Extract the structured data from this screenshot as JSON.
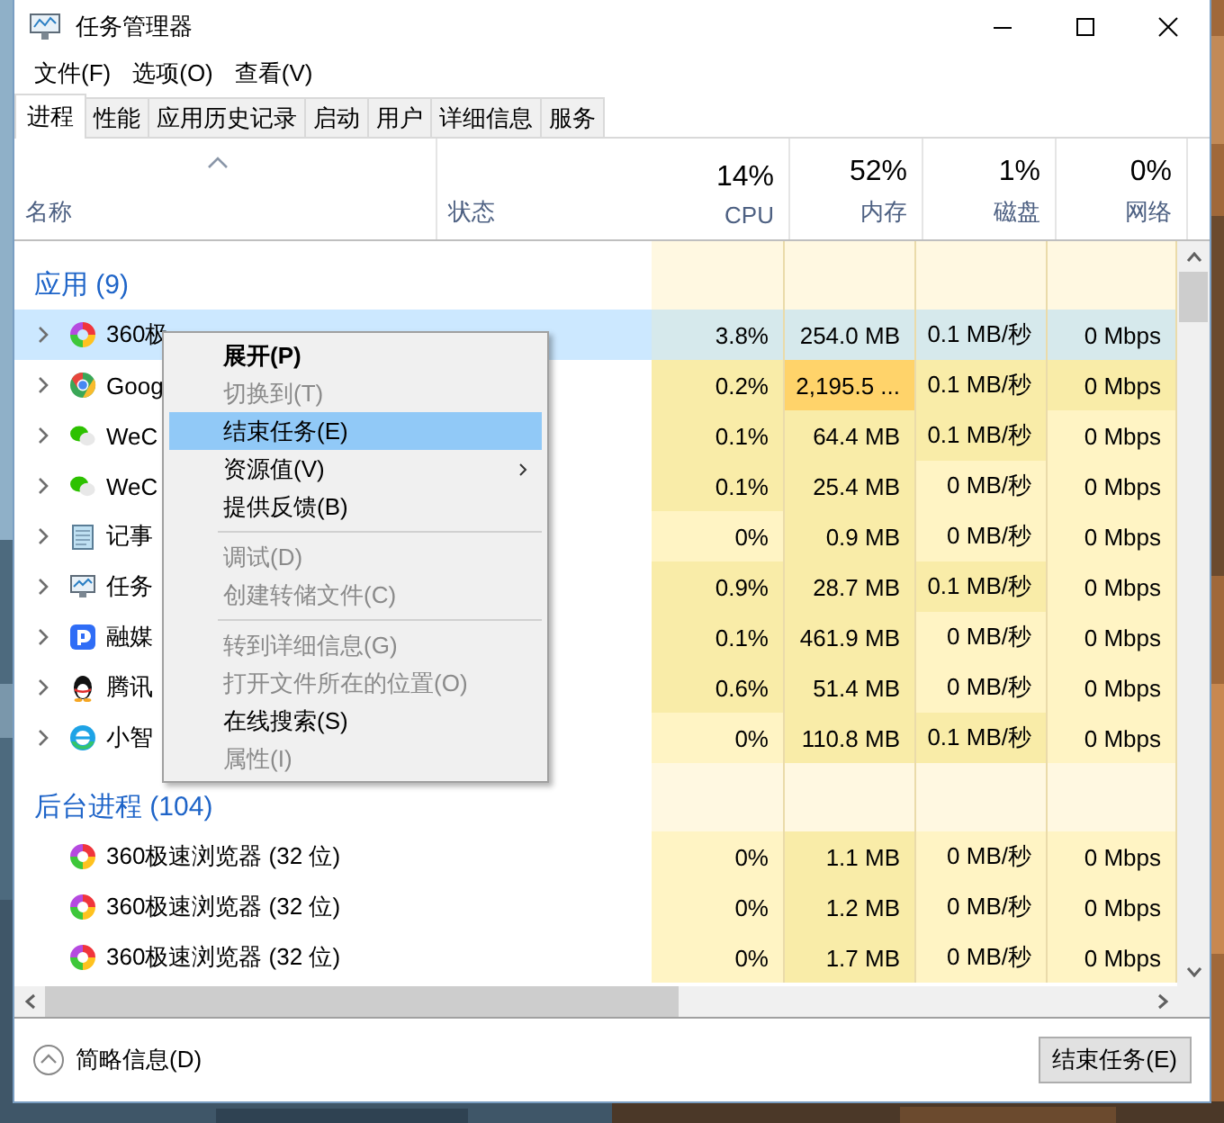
{
  "window": {
    "title": "任务管理器"
  },
  "menu_bar": [
    "文件(F)",
    "选项(O)",
    "查看(V)"
  ],
  "tabs": [
    {
      "label": "进程",
      "selected": true
    },
    {
      "label": "性能",
      "selected": false
    },
    {
      "label": "应用历史记录",
      "selected": false
    },
    {
      "label": "启动",
      "selected": false
    },
    {
      "label": "用户",
      "selected": false
    },
    {
      "label": "详细信息",
      "selected": false
    },
    {
      "label": "服务",
      "selected": false
    }
  ],
  "columns": {
    "name": {
      "label": "名称",
      "sorted": true
    },
    "status": {
      "label": "状态"
    },
    "metrics": [
      {
        "percent": "14%",
        "label": "CPU"
      },
      {
        "percent": "52%",
        "label": "内存"
      },
      {
        "percent": "1%",
        "label": "磁盘"
      },
      {
        "percent": "0%",
        "label": "网络"
      }
    ]
  },
  "groups": [
    {
      "title": "应用 (9)",
      "rows": [
        {
          "name": "360极",
          "expandable": true,
          "selected": true,
          "cells": [
            {
              "text": "3.8%",
              "color": "#d6e9ec"
            },
            {
              "text": "254.0 MB",
              "color": "#d6e9ec"
            },
            {
              "text": "0.1 MB/秒",
              "color": "#d6e9ec"
            },
            {
              "text": "0 Mbps",
              "color": "#d6e9ec"
            }
          ]
        },
        {
          "name": "Goog",
          "expandable": true,
          "selected": false,
          "cells": [
            {
              "text": "0.2%",
              "color": "#f9eca8"
            },
            {
              "text": "2,195.5 ...",
              "color": "#ffd36a"
            },
            {
              "text": "0.1 MB/秒",
              "color": "#f9eca8"
            },
            {
              "text": "0 Mbps",
              "color": "#f9eca8"
            }
          ]
        },
        {
          "name": "WeC",
          "expandable": true,
          "selected": false,
          "cells": [
            {
              "text": "0.1%",
              "color": "#f9eca8"
            },
            {
              "text": "64.4 MB",
              "color": "#f9eca8"
            },
            {
              "text": "0.1 MB/秒",
              "color": "#f9eca8"
            },
            {
              "text": "0 Mbps",
              "color": "#fff4c4"
            }
          ]
        },
        {
          "name": "WeC",
          "expandable": true,
          "selected": false,
          "cells": [
            {
              "text": "0.1%",
              "color": "#f9eca8"
            },
            {
              "text": "25.4 MB",
              "color": "#f9eca8"
            },
            {
              "text": "0 MB/秒",
              "color": "#fff4c4"
            },
            {
              "text": "0 Mbps",
              "color": "#fff4c4"
            }
          ]
        },
        {
          "name": "记事",
          "expandable": true,
          "selected": false,
          "cells": [
            {
              "text": "0%",
              "color": "#fff4c4"
            },
            {
              "text": "0.9 MB",
              "color": "#f9eca8"
            },
            {
              "text": "0 MB/秒",
              "color": "#fff4c4"
            },
            {
              "text": "0 Mbps",
              "color": "#fff4c4"
            }
          ]
        },
        {
          "name": "任务",
          "expandable": true,
          "selected": false,
          "cells": [
            {
              "text": "0.9%",
              "color": "#f9eca8"
            },
            {
              "text": "28.7 MB",
              "color": "#f9eca8"
            },
            {
              "text": "0.1 MB/秒",
              "color": "#f9eca8"
            },
            {
              "text": "0 Mbps",
              "color": "#fff4c4"
            }
          ]
        },
        {
          "name": "融媒",
          "expandable": true,
          "selected": false,
          "cells": [
            {
              "text": "0.1%",
              "color": "#f9eca8"
            },
            {
              "text": "461.9 MB",
              "color": "#f9eca8"
            },
            {
              "text": "0 MB/秒",
              "color": "#fff4c4"
            },
            {
              "text": "0 Mbps",
              "color": "#fff4c4"
            }
          ]
        },
        {
          "name": "腾讯",
          "expandable": true,
          "selected": false,
          "cells": [
            {
              "text": "0.6%",
              "color": "#f9eca8"
            },
            {
              "text": "51.4 MB",
              "color": "#f9eca8"
            },
            {
              "text": "0 MB/秒",
              "color": "#fff4c4"
            },
            {
              "text": "0 Mbps",
              "color": "#fff4c4"
            }
          ]
        },
        {
          "name": "小智",
          "expandable": true,
          "selected": false,
          "cells": [
            {
              "text": "0%",
              "color": "#fff4c4"
            },
            {
              "text": "110.8 MB",
              "color": "#f9eca8"
            },
            {
              "text": "0.1 MB/秒",
              "color": "#f9eca8"
            },
            {
              "text": "0 Mbps",
              "color": "#fff4c4"
            }
          ]
        }
      ]
    },
    {
      "title": "后台进程 (104)",
      "rows": [
        {
          "name": "360极速浏览器 (32 位)",
          "expandable": false,
          "selected": false,
          "cells": [
            {
              "text": "0%",
              "color": "#fff4c4"
            },
            {
              "text": "1.1 MB",
              "color": "#f9eca8"
            },
            {
              "text": "0 MB/秒",
              "color": "#fff4c4"
            },
            {
              "text": "0 Mbps",
              "color": "#fff4c4"
            }
          ]
        },
        {
          "name": "360极速浏览器 (32 位)",
          "expandable": false,
          "selected": false,
          "cells": [
            {
              "text": "0%",
              "color": "#fff4c4"
            },
            {
              "text": "1.2 MB",
              "color": "#f9eca8"
            },
            {
              "text": "0 MB/秒",
              "color": "#fff4c4"
            },
            {
              "text": "0 Mbps",
              "color": "#fff4c4"
            }
          ]
        },
        {
          "name": "360极速浏览器 (32 位)",
          "expandable": false,
          "selected": false,
          "cells": [
            {
              "text": "0%",
              "color": "#fff4c4"
            },
            {
              "text": "1.7 MB",
              "color": "#f9eca8"
            },
            {
              "text": "0 MB/秒",
              "color": "#fff4c4"
            },
            {
              "text": "0 Mbps",
              "color": "#fff4c4"
            }
          ]
        }
      ]
    }
  ],
  "context_menu": [
    {
      "kind": "item",
      "label": "展开(P)",
      "default": true,
      "disabled": false,
      "selected": false,
      "submenu": false
    },
    {
      "kind": "item",
      "label": "切换到(T)",
      "default": false,
      "disabled": true,
      "selected": false,
      "submenu": false
    },
    {
      "kind": "item",
      "label": "结束任务(E)",
      "default": false,
      "disabled": false,
      "selected": true,
      "submenu": false
    },
    {
      "kind": "item",
      "label": "资源值(V)",
      "default": false,
      "disabled": false,
      "selected": false,
      "submenu": true
    },
    {
      "kind": "item",
      "label": "提供反馈(B)",
      "default": false,
      "disabled": false,
      "selected": false,
      "submenu": false
    },
    {
      "kind": "separator"
    },
    {
      "kind": "item",
      "label": "调试(D)",
      "default": false,
      "disabled": true,
      "selected": false,
      "submenu": false
    },
    {
      "kind": "item",
      "label": "创建转储文件(C)",
      "default": false,
      "disabled": true,
      "selected": false,
      "submenu": false
    },
    {
      "kind": "separator"
    },
    {
      "kind": "item",
      "label": "转到详细信息(G)",
      "default": false,
      "disabled": true,
      "selected": false,
      "submenu": false
    },
    {
      "kind": "item",
      "label": "打开文件所在的位置(O)",
      "default": false,
      "disabled": true,
      "selected": false,
      "submenu": false
    },
    {
      "kind": "item",
      "label": "在线搜索(S)",
      "default": false,
      "disabled": false,
      "selected": false,
      "submenu": false
    },
    {
      "kind": "item",
      "label": "属性(I)",
      "default": false,
      "disabled": true,
      "selected": false,
      "submenu": false
    }
  ],
  "footer": {
    "details_link": "简略信息(D)",
    "end_task_button": "结束任务(E)"
  }
}
